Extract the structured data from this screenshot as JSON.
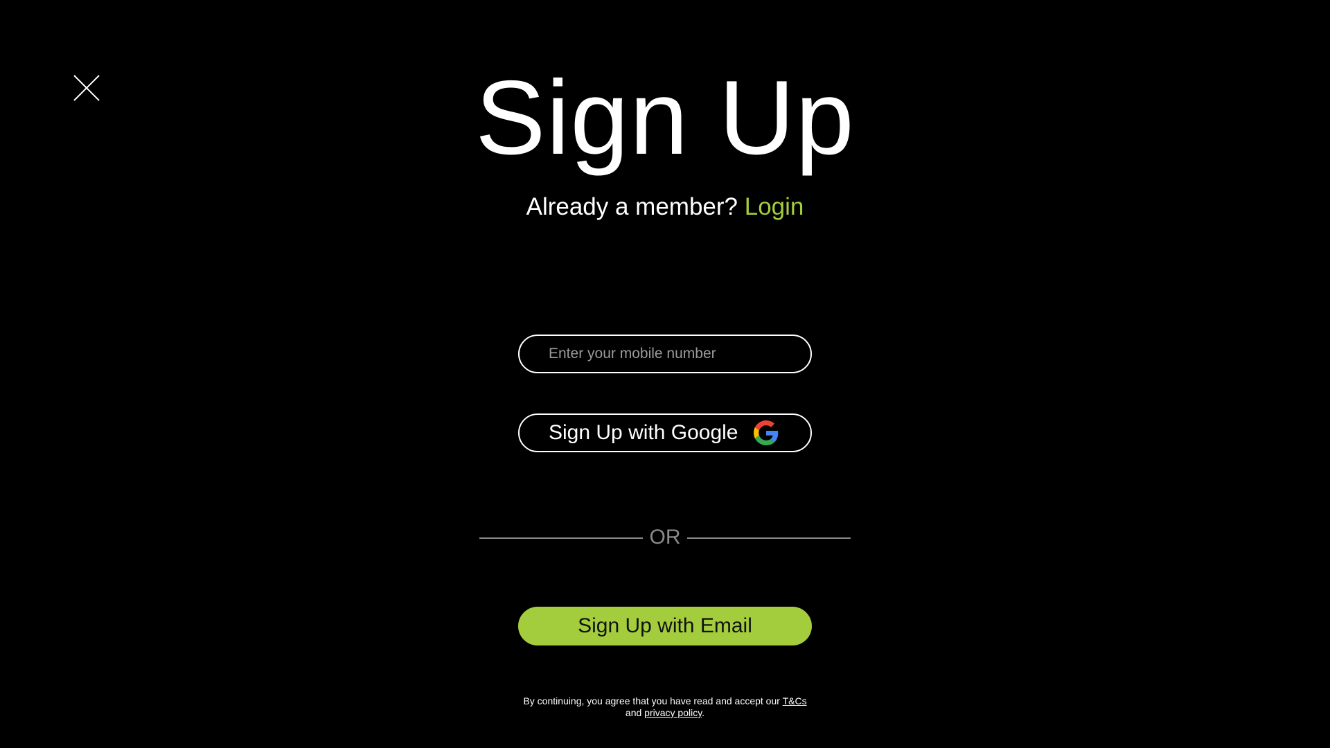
{
  "page": {
    "title": "Sign Up",
    "member_prompt": "Already a member?",
    "login_label": "Login"
  },
  "form": {
    "mobile_placeholder": "Enter your mobile number",
    "google_button_label": "Sign Up with Google",
    "or_label": "OR",
    "email_button_label": "Sign Up with Email"
  },
  "terms": {
    "line1_prefix": "By continuing, you agree that you have read  and accept our",
    "tcs_label": "T&Cs",
    "line2_prefix": "and",
    "privacy_label": "privacy policy",
    "line2_suffix": "."
  },
  "icons": {
    "close": "close-icon",
    "google": "google-icon"
  },
  "colors": {
    "background": "#000000",
    "accent": "#a4cd3d",
    "divider": "#8a8a8a"
  }
}
